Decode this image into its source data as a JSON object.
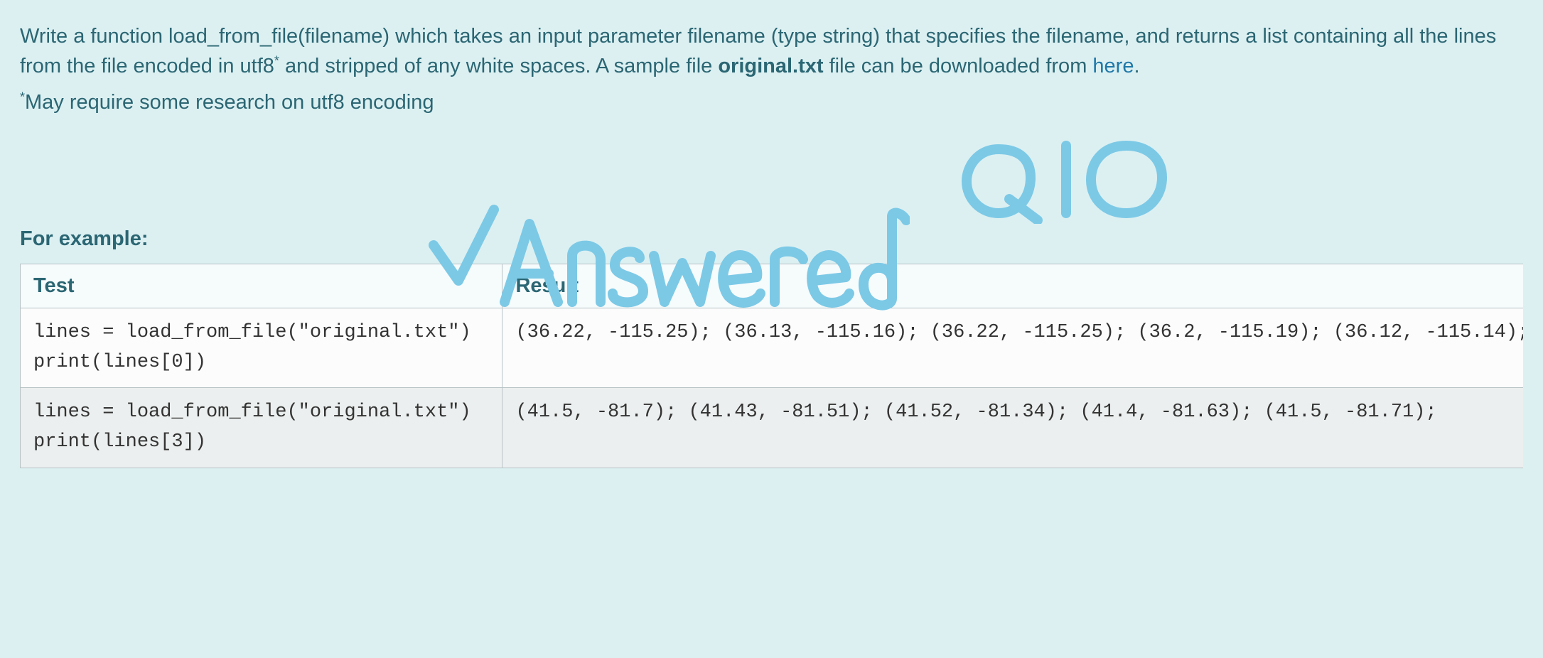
{
  "question": {
    "part1": "Write a function load_from_file(filename) which takes an input parameter filename (type string) that specifies the filename, and returns a list containing all the lines from the file encoded in utf8",
    "sup1": "*",
    "part2": " and stripped of any white spaces. A sample file ",
    "bold_file": "original.txt",
    "part3": " file can be downloaded from ",
    "link_text": "here",
    "part4": "."
  },
  "footnote": {
    "star": "*",
    "text": "May require some research on utf8 encoding"
  },
  "example_label": "For example:",
  "table": {
    "headers": {
      "test": "Test",
      "result": "Result"
    },
    "rows": [
      {
        "test": "lines = load_from_file(\"original.txt\")\nprint(lines[0])",
        "result": "(36.22, -115.25); (36.13, -115.16); (36.22, -115.25); (36.2, -115.19); (36.12, -115.14);"
      },
      {
        "test": "lines = load_from_file(\"original.txt\")\nprint(lines[3])",
        "result": "(41.5, -81.7); (41.43, -81.51); (41.52, -81.34); (41.4, -81.63); (41.5, -81.71);"
      }
    ]
  },
  "annotations": {
    "q_label": "Q10",
    "answered": "Answered"
  }
}
